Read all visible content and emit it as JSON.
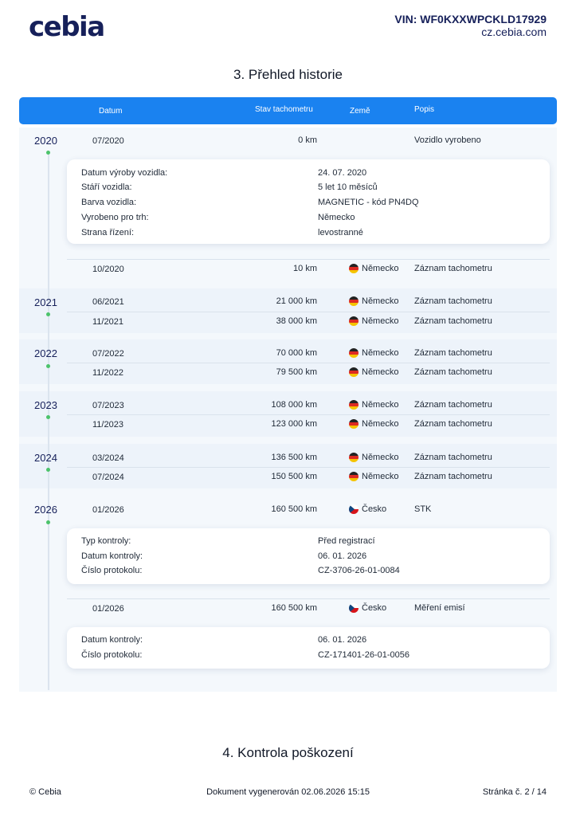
{
  "header": {
    "logo": "cebia",
    "vin": "VIN: WF0KXXWPCKLD17929",
    "site": "cz.cebia.com"
  },
  "section3_title": "3. Přehled historie",
  "table_header": {
    "date": "Datum",
    "odometer": "Stav tachometru",
    "country": "Země",
    "description": "Popis"
  },
  "years": [
    "2020",
    "2021",
    "2022",
    "2023",
    "2024",
    "2026"
  ],
  "rows": [
    {
      "date": "07/2020",
      "odometer": "0 km",
      "country": "",
      "flag": "",
      "description": "Vozidlo vyrobeno"
    },
    {
      "date": "10/2020",
      "odometer": "10 km",
      "country": "Německo",
      "flag": "de",
      "description": "Záznam tachometru"
    },
    {
      "date": "06/2021",
      "odometer": "21 000 km",
      "country": "Německo",
      "flag": "de",
      "description": "Záznam tachometru"
    },
    {
      "date": "11/2021",
      "odometer": "38 000 km",
      "country": "Německo",
      "flag": "de",
      "description": "Záznam tachometru"
    },
    {
      "date": "07/2022",
      "odometer": "70 000 km",
      "country": "Německo",
      "flag": "de",
      "description": "Záznam tachometru"
    },
    {
      "date": "11/2022",
      "odometer": "79 500 km",
      "country": "Německo",
      "flag": "de",
      "description": "Záznam tachometru"
    },
    {
      "date": "07/2023",
      "odometer": "108 000 km",
      "country": "Německo",
      "flag": "de",
      "description": "Záznam tachometru"
    },
    {
      "date": "11/2023",
      "odometer": "123 000 km",
      "country": "Německo",
      "flag": "de",
      "description": "Záznam tachometru"
    },
    {
      "date": "03/2024",
      "odometer": "136 500 km",
      "country": "Německo",
      "flag": "de",
      "description": "Záznam tachometru"
    },
    {
      "date": "07/2024",
      "odometer": "150 500 km",
      "country": "Německo",
      "flag": "de",
      "description": "Záznam tachometru"
    },
    {
      "date": "01/2026",
      "odometer": "160 500 km",
      "country": "Česko",
      "flag": "cz",
      "description": "STK"
    },
    {
      "date": "01/2026",
      "odometer": "160 500 km",
      "country": "Česko",
      "flag": "cz",
      "description": "Měření emisí"
    }
  ],
  "details_production": [
    {
      "label": "Datum výroby vozidla:",
      "value": "24. 07. 2020"
    },
    {
      "label": "Stáří vozidla:",
      "value": "5 let 10 měsíců"
    },
    {
      "label": "Barva vozidla:",
      "value": "MAGNETIC - kód PN4DQ"
    },
    {
      "label": "Vyrobeno pro trh:",
      "value": "Německo"
    },
    {
      "label": "Strana řízení:",
      "value": "levostranné"
    }
  ],
  "details_stk": [
    {
      "label": "Typ kontroly:",
      "value": "Před registrací"
    },
    {
      "label": "Datum kontroly:",
      "value": "06. 01. 2026"
    },
    {
      "label": "Číslo protokolu:",
      "value": "CZ-3706-26-01-0084"
    }
  ],
  "details_emise": [
    {
      "label": "Datum kontroly:",
      "value": "06. 01. 2026"
    },
    {
      "label": "Číslo protokolu:",
      "value": "CZ-171401-26-01-0056"
    }
  ],
  "section4_title": "4. Kontrola poškození",
  "footer": {
    "copyright": "© Cebia",
    "generated": "Dokument vygenerován 02.06.2026 15:15",
    "page": "Stránka č. 2 / 14"
  }
}
